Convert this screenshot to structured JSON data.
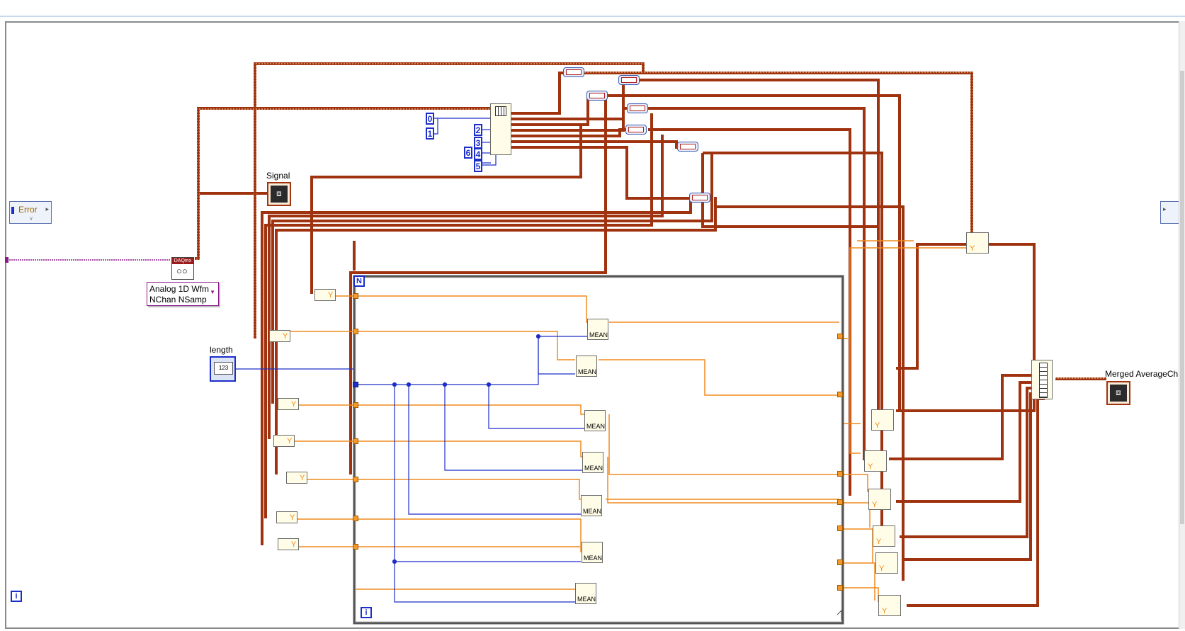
{
  "labels": {
    "signal": "Signal",
    "length": "length",
    "merged": "Merged AverageCh",
    "error": "Error",
    "daq_line1": "Analog 1D Wfm",
    "daq_line2": "NChan NSamp",
    "loop_count": "N",
    "iteration": "i",
    "outer_iteration": "i",
    "daq_caption": "DAQmx",
    "numeric_caption": "123",
    "mean": "MEAN",
    "y_glyph": "Y"
  },
  "constants": [
    "0",
    "1",
    "2",
    "3",
    "6",
    "4",
    "5"
  ],
  "colors": {
    "waveform_wire": "#a0330f",
    "numeric_wire": "#f08a1c",
    "int_wire": "#1c2fc8",
    "task_wire": "#8b1a8b",
    "frame": "#8a8a8a"
  },
  "icons": {
    "daq": "daqmx-read-icon",
    "graph": "waveform-graph-icon",
    "numeric": "numeric-control-icon",
    "array": "index-array-icon",
    "build": "build-array-icon"
  }
}
